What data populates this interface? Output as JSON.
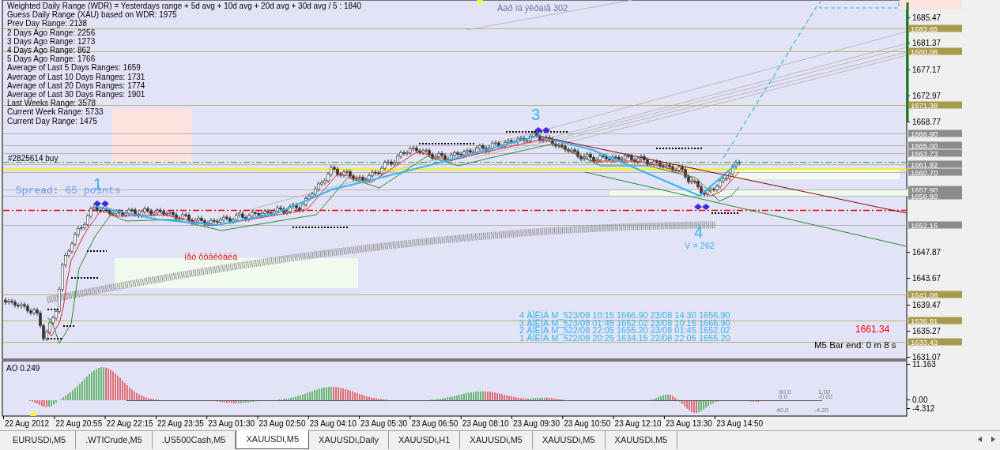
{
  "info_lines": [
    "Weighted Daily Range (WDR) = Yesterdays range + 5d avg + 10d avg + 20d avg + 30d avg / 5 : 1840",
    "Guess Daily Range (XAU) based on WDR: 1975",
    "Prev Day Range: 2138",
    "2 Days Ago Range: 2256",
    "3 Days Ago Range: 1273",
    "4 Days Ago Range: 862",
    "5 Days Ago Range: 1766",
    "Average of Last 5 Days Ranges: 1659",
    "Average of Last 10 Days Ranges: 1731",
    "Average of Last 20 Days Ranges: 1774",
    "Average of Last 30 Days Ranges: 1901",
    "Last Weeks Range: 3578",
    "Current Week Range: 5733",
    "Current Day Range: 1475"
  ],
  "order_label": "#2825614 buy",
  "spread": "Spread: 65 points",
  "top_note": "Àäð ïä ýêðàíå 302",
  "mid_note": "íåò ôôâêôàëà",
  "waves": [
    {
      "label": "1"
    },
    {
      "label": "3"
    },
    {
      "label": "4"
    }
  ],
  "volume": "V = 262",
  "wave_list": [
    "4 ÂÎËÍÀ M_523/08 10:15 1666.90 23/08 14:30 1656.90",
    "3 ÂÎËÍÀ M_523/08 01:45 1652.02 23/08 10:15 1666.90",
    "2 ÂÎËÍÀ M_522/08 22:05 1655.20 23/08 01:45 1652.02",
    "1 ÂÎËÍÀ M_522/08 20:25 1634.15 22/08 22:05 1655.20"
  ],
  "last_price": "1661.34",
  "bar_timer": "M5 Bar end: 0 m 8 s",
  "price_axis": [
    "1685.47",
    "1681.37",
    "1677.17",
    "1672.97",
    "1668.77",
    "1647.87",
    "1643.67",
    "1639.47",
    "1635.27",
    "1631.07"
  ],
  "levels": [
    {
      "label": "1683.65",
      "kind": "gold"
    },
    {
      "label": "1680.08",
      "kind": "gold"
    },
    {
      "label": "1671.38",
      "kind": "gold"
    },
    {
      "label": "1666.90",
      "kind": "grey"
    },
    {
      "label": "1665.00",
      "kind": "grey"
    },
    {
      "label": "1663.73",
      "kind": "grey"
    },
    {
      "label": "1661.92",
      "kind": "grey"
    },
    {
      "label": "1660.70",
      "kind": "grey"
    },
    {
      "label": "1657.90",
      "kind": "grey"
    },
    {
      "label": "1656.90",
      "kind": "grey"
    },
    {
      "label": "1652.15",
      "kind": "grey"
    },
    {
      "label": "1641.08",
      "kind": "gold"
    },
    {
      "label": "1636.91",
      "kind": "gold"
    },
    {
      "label": "1633.43",
      "kind": "gold"
    }
  ],
  "ao_panel": {
    "title": "AO 0.249",
    "axis": [
      "11.163",
      "0.00",
      "-4.312"
    ],
    "labels": [
      "90.0",
      "1.02",
      "0.0",
      "-0.02",
      "40.0",
      "-4.20"
    ]
  },
  "time_axis": [
    "22 Aug 2012",
    "22 Aug 20:55",
    "22 Aug 22:15",
    "22 Aug 23:35",
    "23 Aug 01:30",
    "23 Aug 02:50",
    "23 Aug 04:10",
    "23 Aug 05:30",
    "23 Aug 06:50",
    "23 Aug 08:10",
    "23 Aug 09:30",
    "23 Aug 10:50",
    "23 Aug 12:10",
    "23 Aug 13:30",
    "23 Aug 14:50"
  ],
  "tabs": [
    {
      "label": "EURUSDi,M5",
      "selected": false
    },
    {
      "label": ".WTICrude,M5",
      "selected": false
    },
    {
      "label": ".US500Cash,M5",
      "selected": false
    },
    {
      "label": "XAUUSDi,M5",
      "selected": true
    },
    {
      "label": "XAUUSDi,Daily",
      "selected": false
    },
    {
      "label": "XAUUSDi,H1",
      "selected": false
    },
    {
      "label": "XAUUSDi,M5",
      "selected": false
    },
    {
      "label": "XAUUSDi,M5",
      "selected": false
    },
    {
      "label": "XAUUSDi,M5",
      "selected": false
    }
  ]
}
